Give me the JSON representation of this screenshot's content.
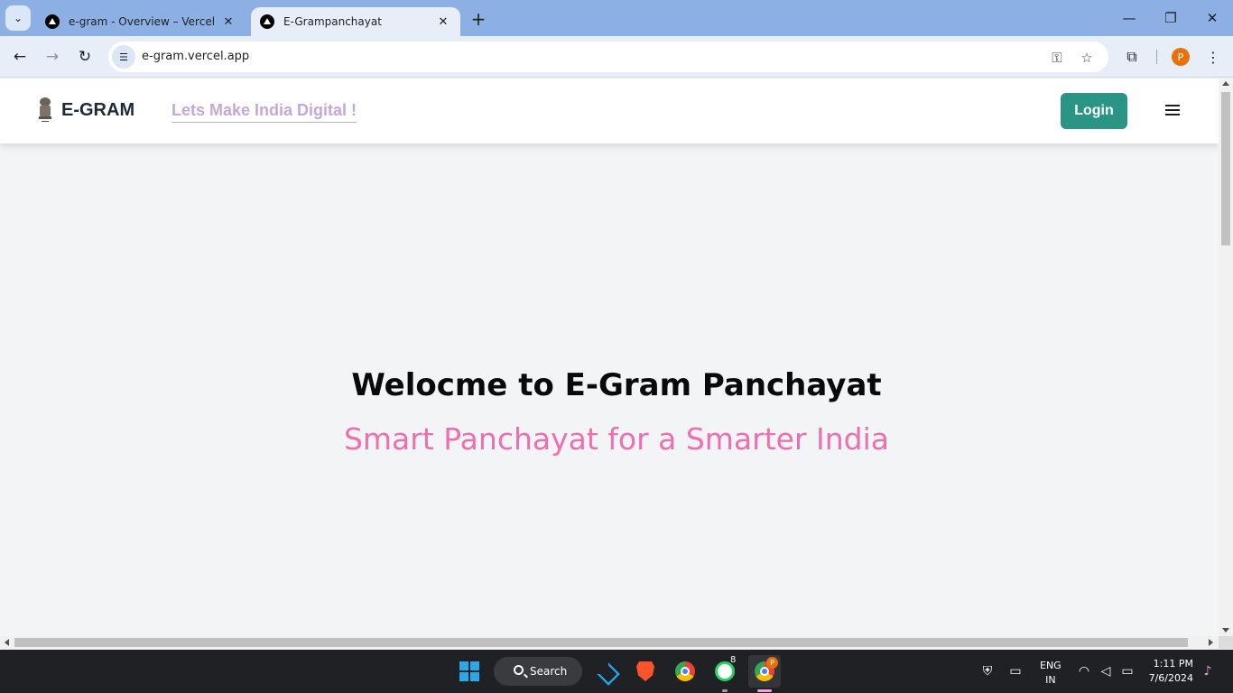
{
  "browser": {
    "tabs": [
      {
        "title": "e-gram - Overview – Vercel",
        "close": "✕"
      },
      {
        "title": "E-Grampanchayat",
        "close": "✕"
      }
    ],
    "new_tab": "+",
    "url": "e-gram.vercel.app",
    "window_controls": {
      "minimize": "—",
      "restore": "❐",
      "close": "✕"
    }
  },
  "site": {
    "brand": "E-GRAM",
    "tagline": "Lets Make India Digital !",
    "login_label": "Login",
    "hero_title": "Welocme to E-Gram Panchayat",
    "hero_subtitle": "Smart Panchayat for a Smarter India"
  },
  "taskbar": {
    "search_label": "Search",
    "whatsapp_badge": "8",
    "chrome_profile_badge": "P",
    "language": "ENG",
    "region": "IN",
    "time": "1:11 PM",
    "date": "7/6/2024"
  },
  "colors": {
    "login_button": "#2a9485",
    "tagline": "#c4a8d8",
    "hero_subtitle": "#ec6fb0"
  }
}
